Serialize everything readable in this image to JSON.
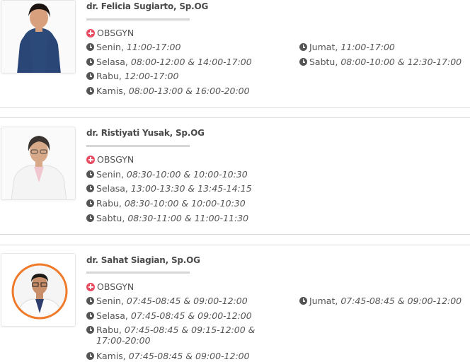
{
  "doctors": [
    {
      "name": "dr. Felicia Sugiarto, Sp.OG",
      "specialty": "OBSGYN",
      "schedule_left": [
        {
          "day": "Senin,",
          "time": "11:00-17:00"
        },
        {
          "day": "Selasa,",
          "time": "08:00-12:00 & 14:00-17:00"
        },
        {
          "day": "Rabu,",
          "time": "12:00-17:00"
        },
        {
          "day": "Kamis,",
          "time": "08:00-13:00 & 16:00-20:00"
        }
      ],
      "schedule_right": [
        {
          "day": "Jumat,",
          "time": "11:00-17:00"
        },
        {
          "day": "Sabtu,",
          "time": "08:00-10:00 & 12:30-17:00"
        }
      ]
    },
    {
      "name": "dr. Ristiyati Yusak, Sp.OG",
      "specialty": "OBSGYN",
      "schedule_left": [
        {
          "day": "Senin,",
          "time": "08:30-10:00 & 10:00-10:30"
        },
        {
          "day": "Selasa,",
          "time": "13:00-13:30 & 13:45-14:15"
        },
        {
          "day": "Rabu,",
          "time": "08:30-10:00 & 10:00-10:30"
        },
        {
          "day": "Sabtu,",
          "time": "08:30-11:00 & 11:00-11:30"
        }
      ],
      "schedule_right": []
    },
    {
      "name": "dr. Sahat Siagian, Sp.OG",
      "specialty": "OBSGYN",
      "schedule_left": [
        {
          "day": "Senin,",
          "time": "07:45-08:45 & 09:00-12:00"
        },
        {
          "day": "Selasa,",
          "time": "07:45-08:45 & 09:00-12:00"
        },
        {
          "day": "Rabu,",
          "time": "07:45-08:45 & 09:15-12:00 & 17:00-20:00"
        },
        {
          "day": "Kamis,",
          "time": "07:45-08:45 & 09:00-12:00"
        }
      ],
      "schedule_right": [
        {
          "day": "Jumat,",
          "time": "07:45-08:45 & 09:00-12:00"
        }
      ]
    }
  ],
  "colors": {
    "specialty_icon": "#e84a5f",
    "accent_ring": "#f07a2a",
    "text": "#555555"
  }
}
